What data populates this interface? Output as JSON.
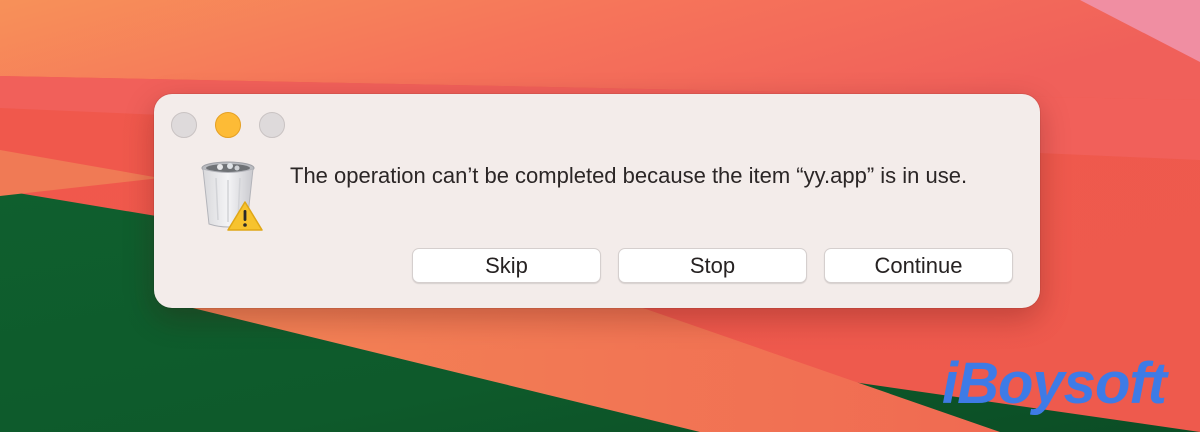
{
  "dialog": {
    "message": "The operation can’t be completed because the item “yy.app” is in use.",
    "icon": "trash-warning-icon",
    "buttons": {
      "skip": "Skip",
      "stop": "Stop",
      "continue": "Continue"
    }
  },
  "window_controls": [
    "close",
    "minimize",
    "zoom"
  ],
  "watermark": "iBoysoft",
  "colors": {
    "dialog_bg": "#f3ecea",
    "minimize": "#fdbb36",
    "inactive_control": "#dedadb",
    "brand": "#3e7be6",
    "wallpaper_green": "#0f5a2c",
    "wallpaper_red": "#ef5a4b"
  }
}
